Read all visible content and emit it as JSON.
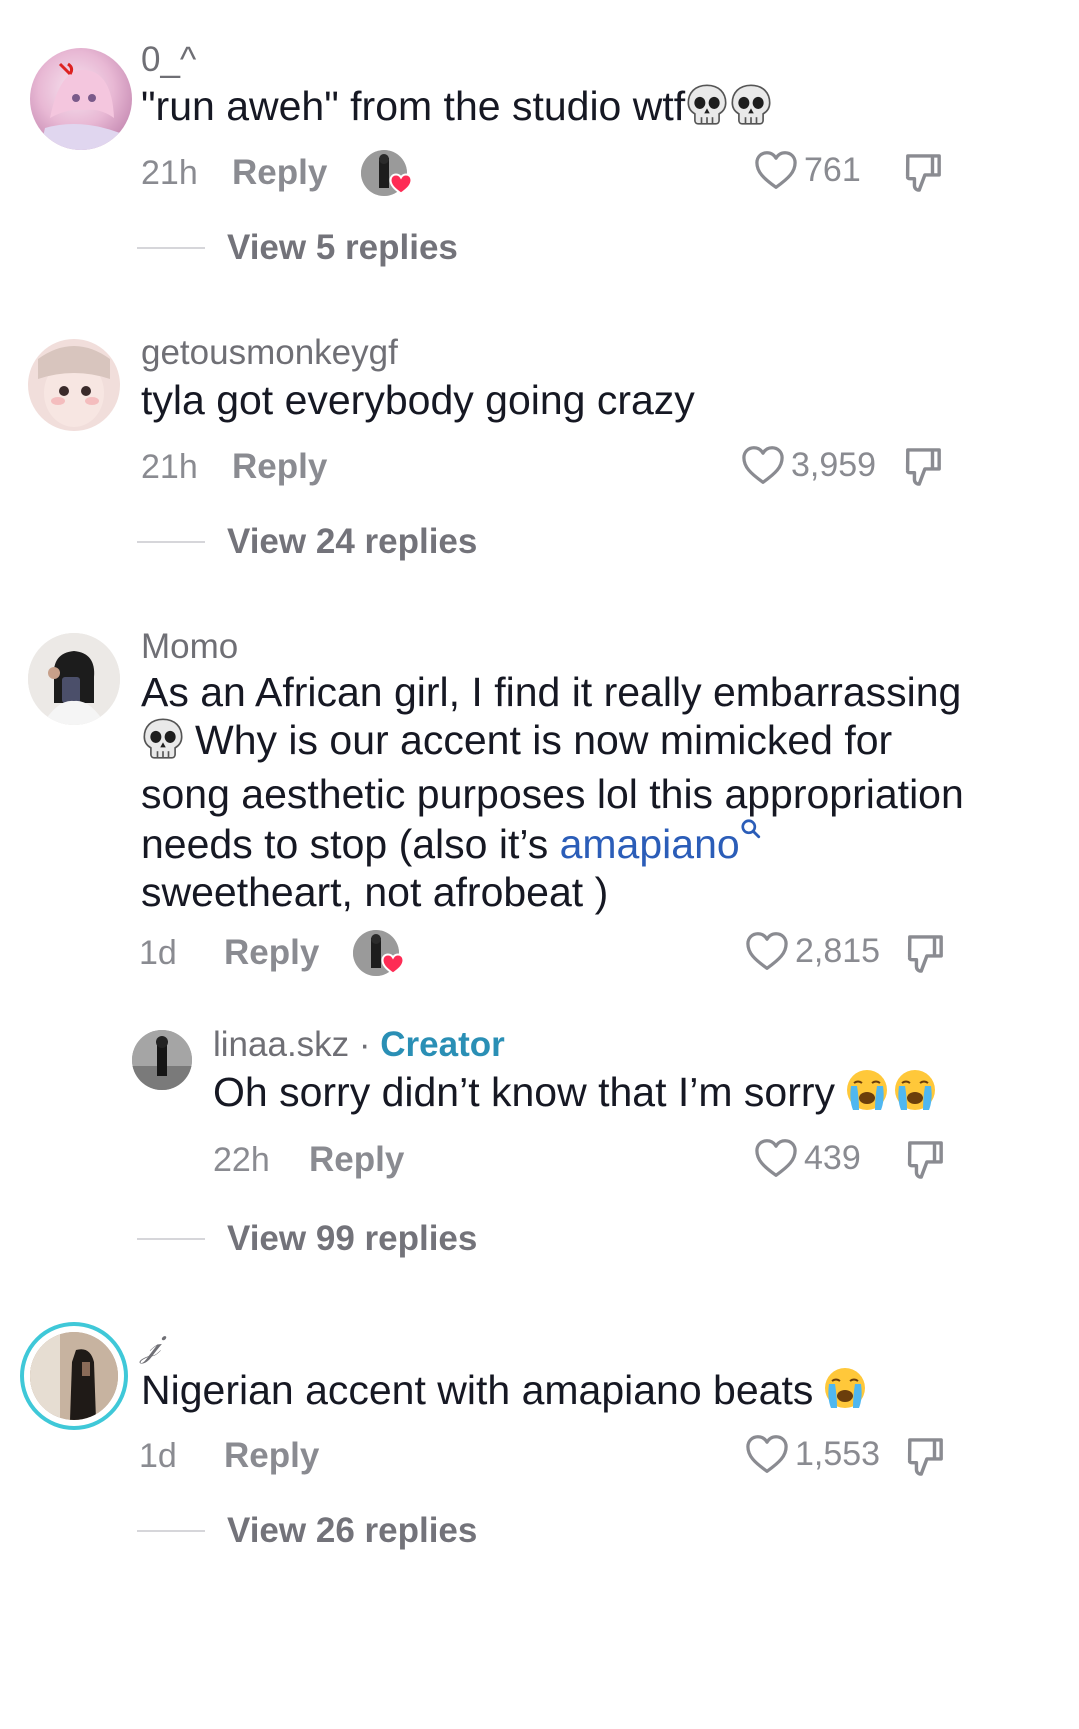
{
  "comments": [
    {
      "username": "0_^",
      "text": "\"run aweh\" from the studio wtf",
      "time": "21h",
      "reply_label": "Reply",
      "likes": "761",
      "view_replies": "View 5 replies"
    },
    {
      "username": "getousmonkeygf",
      "text": "tyla got everybody going crazy",
      "time": "21h",
      "reply_label": "Reply",
      "likes": "3,959",
      "view_replies": "View 24 replies"
    },
    {
      "username": "Momo",
      "text_line1": "As an African girl, I find it really embarrassing",
      "text_line2": "Why is our accent is now mimicked for",
      "text_line3": "song aesthetic purposes lol this appropriation",
      "text_line4a": "needs to stop (also it’s ",
      "text_line4_link": "amapiano",
      "text_line5": "sweetheart, not afrobeat )",
      "time": "1d",
      "reply_label": "Reply",
      "likes": "2,815",
      "view_replies": "View 99 replies",
      "reply": {
        "username": "linaa.skz",
        "separator": " · ",
        "badge": "Creator",
        "text": "Oh sorry didn’t know that I’m sorry",
        "time": "22h",
        "reply_label": "Reply",
        "likes": "439"
      }
    },
    {
      "username": "𝒿",
      "text": "Nigerian accent with amapiano beats",
      "time": "1d",
      "reply_label": "Reply",
      "likes": "1,553",
      "view_replies": "View 26 replies"
    }
  ],
  "icons": {
    "like": "heart-outline-icon",
    "dislike": "thumbs-down-icon",
    "skull": "skull-emoji",
    "crying": "loudly-crying-emoji",
    "search": "search-icon"
  },
  "colors": {
    "link": "#2b5db8",
    "creator": "#2a8fb5",
    "heart": "#fe2c55",
    "story_ring": "#3fc8d8"
  }
}
